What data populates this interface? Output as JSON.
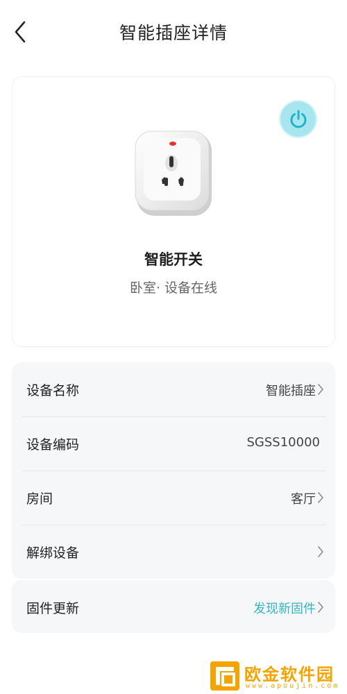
{
  "header": {
    "title": "智能插座详情",
    "back_icon": "chevron-left-icon"
  },
  "device": {
    "name": "智能开关",
    "status": "卧室· 设备在线",
    "power_icon": "power-icon",
    "accent": "#36b5c4"
  },
  "info": {
    "rows": [
      {
        "label": "设备名称",
        "value": "智能插座"
      },
      {
        "label": "设备编码",
        "value": "SGSS10000"
      },
      {
        "label": "房间",
        "value": "客厅"
      },
      {
        "label": "解绑设备",
        "value": ""
      }
    ]
  },
  "firmware": {
    "label": "固件更新",
    "value": "发现新固件"
  },
  "watermark": {
    "title": "欧金软件园",
    "url": "www.apoujin.com"
  }
}
